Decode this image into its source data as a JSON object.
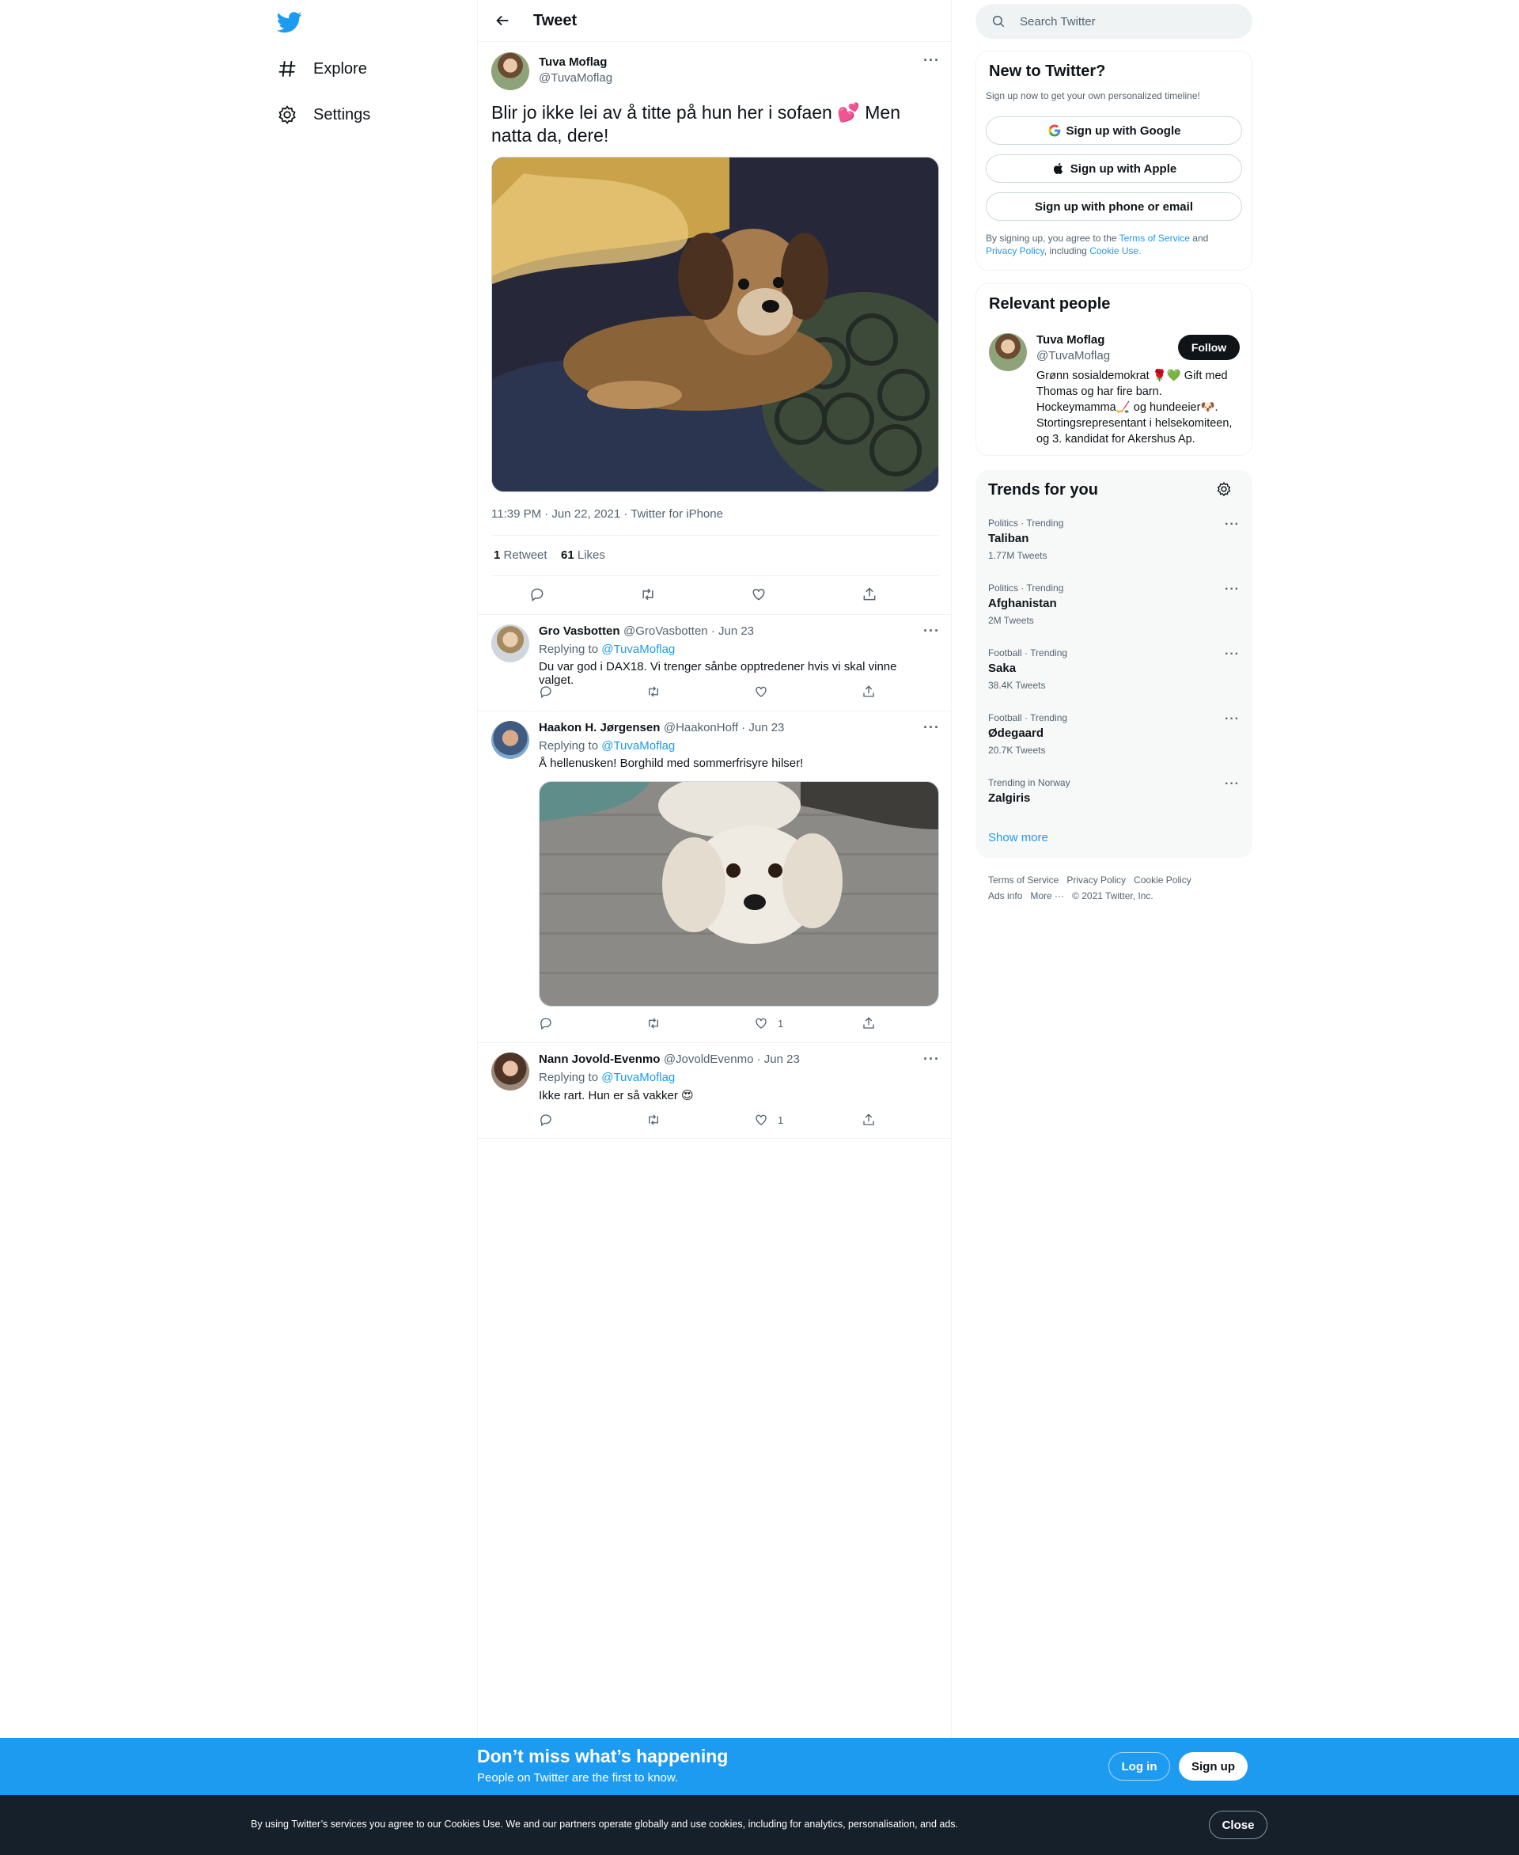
{
  "nav": {
    "items": [
      {
        "label": "Explore",
        "icon": "hashtag-icon"
      },
      {
        "label": "Settings",
        "icon": "gear-icon"
      }
    ]
  },
  "header": {
    "title": "Tweet"
  },
  "tweet": {
    "author_name": "Tuva Moflag",
    "author_handle": "@TuvaMoflag",
    "text": "Blir jo ikke lei av å titte på hun her i sofaen 💕 Men natta da, dere!",
    "timestamp": "11:39 PM · Jun 22, 2021 · Twitter for iPhone",
    "retweets_count": "1",
    "retweets_label": "Retweet",
    "likes_count": "61",
    "likes_label": "Likes"
  },
  "replies": [
    {
      "name": "Gro Vasbotten",
      "meta": "@GroVasbotten · Jun 23",
      "replying_prefix": "Replying to",
      "replying_to": "@TuvaMoflag",
      "text": "Du var god i DAX18. Vi trenger sånbe opptredener hvis vi skal vinne valget.",
      "likes": ""
    },
    {
      "name": "Haakon H. Jørgensen",
      "meta": "@HaakonHoff · Jun 23",
      "replying_prefix": "Replying to",
      "replying_to": "@TuvaMoflag",
      "text": "Å hellenusken! Borghild med sommerfrisyre hilser!",
      "likes": "1"
    },
    {
      "name": "Nann Jovold-Evenmo",
      "meta": "@JovoldEvenmo · Jun 23",
      "replying_prefix": "Replying to",
      "replying_to": "@TuvaMoflag",
      "text": "Ikke rart. Hun er så vakker 😍",
      "likes": "1"
    }
  ],
  "search": {
    "placeholder": "Search Twitter"
  },
  "signup": {
    "title": "New to Twitter?",
    "subtitle": "Sign up now to get your own personalized timeline!",
    "google": "Sign up with Google",
    "apple": "Sign up with Apple",
    "phone": "Sign up with phone or email",
    "legal_1": "By signing up, you agree to the",
    "tos": "Terms of Service",
    "legal_and": "and",
    "privacy": "Privacy Policy",
    "legal_including": ", including",
    "cookie": "Cookie Use."
  },
  "relevant": {
    "title": "Relevant people",
    "name": "Tuva Moflag",
    "handle": "@TuvaMoflag",
    "follow": "Follow",
    "bio": "Grønn sosialdemokrat 🌹💚 Gift med Thomas og har fire barn. Hockeymamma🏒 og hundeeier🐶. Stortingsrepresentant i helsekomiteen, og 3. kandidat for Akershus Ap."
  },
  "trends": {
    "title": "Trends for you",
    "items": [
      {
        "category": "Politics · Trending",
        "name": "Taliban",
        "count": "1.77M Tweets"
      },
      {
        "category": "Politics · Trending",
        "name": "Afghanistan",
        "count": "2M Tweets"
      },
      {
        "category": "Football · Trending",
        "name": "Saka",
        "count": "38.4K Tweets"
      },
      {
        "category": "Football · Trending",
        "name": "Ødegaard",
        "count": "20.7K Tweets"
      },
      {
        "category": "Trending in Norway",
        "name": "Zalgiris",
        "count": ""
      }
    ],
    "show_more": "Show more"
  },
  "footer": {
    "links": [
      "Terms of Service",
      "Privacy Policy",
      "Cookie Policy",
      "Ads info",
      "More ···"
    ],
    "copyright": "© 2021 Twitter, Inc."
  },
  "banner": {
    "title": "Don’t miss what’s happening",
    "subtitle": "People on Twitter are the first to know.",
    "login": "Log in",
    "signup": "Sign up"
  },
  "cookie_bar": {
    "text": "By using Twitter’s services you agree to our Cookies Use. We and our partners operate globally and use cookies, including for analytics, personalisation, and ads.",
    "close": "Close"
  },
  "colors": {
    "accent": "#1d9bf0",
    "text": "#0f1419",
    "muted": "#536471",
    "dark_bar": "#15202b"
  }
}
